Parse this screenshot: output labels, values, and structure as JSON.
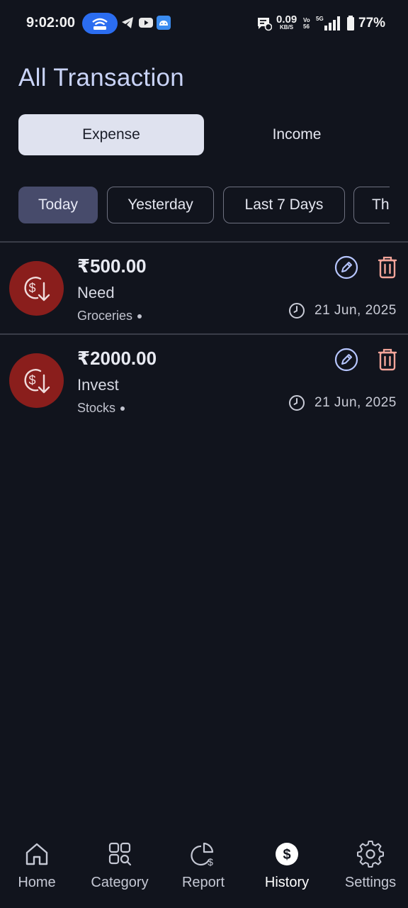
{
  "status_bar": {
    "time": "9:02:00",
    "speed_value": "0.09",
    "speed_unit": "KB/S",
    "volte_top": "Vo",
    "volte_bottom": "56",
    "network": "5G",
    "battery": "77%"
  },
  "header": {
    "title": "All Transaction"
  },
  "type_tabs": [
    {
      "label": "Expense",
      "active": true
    },
    {
      "label": "Income",
      "active": false
    }
  ],
  "date_filters": [
    {
      "label": "Today",
      "active": true
    },
    {
      "label": "Yesterday",
      "active": false
    },
    {
      "label": "Last 7 Days",
      "active": false
    },
    {
      "label": "Th",
      "active": false
    }
  ],
  "transactions": [
    {
      "amount": "₹500.00",
      "title": "Need",
      "category": "Groceries",
      "date": "21 Jun, 2025"
    },
    {
      "amount": "₹2000.00",
      "title": "Invest",
      "category": "Stocks",
      "date": "21 Jun, 2025"
    }
  ],
  "bottom_nav": [
    {
      "label": "Home",
      "icon": "home-icon",
      "active": false
    },
    {
      "label": "Category",
      "icon": "category-icon",
      "active": false
    },
    {
      "label": "Report",
      "icon": "report-icon",
      "active": false
    },
    {
      "label": "History",
      "icon": "dollar-circle-icon",
      "active": true
    },
    {
      "label": "Settings",
      "icon": "gear-icon",
      "active": false
    }
  ],
  "colors": {
    "background": "#11141d",
    "title": "#c9d3f7",
    "active_chip": "#474b6b",
    "expense_avatar": "#8a1e1c",
    "edit_icon": "#b7c6ff",
    "delete_icon": "#f4a59a"
  }
}
